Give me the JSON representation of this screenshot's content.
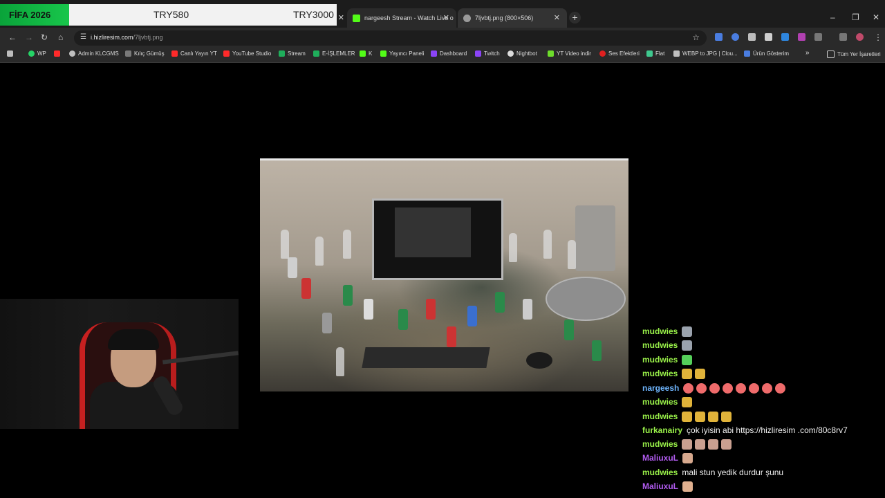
{
  "banner": {
    "green_text": "FİFA 2026",
    "mid_text": "TRY580",
    "right_text": "TRY3000"
  },
  "tabs": [
    {
      "title": "nargeesh Stream - Watch Live o",
      "favicon_color": "#53fc18"
    },
    {
      "title": "7ljvbtj.png (800×506)",
      "favicon_color": "#9a9a9a"
    }
  ],
  "address": {
    "domain": "i.hizliresim.com",
    "path": "/7ljvbtj.png"
  },
  "bookmarks": [
    {
      "label": "WP",
      "color": "#25d366"
    },
    {
      "label": "",
      "color": "#ff2a2a"
    },
    {
      "label": "Admin KLCGMS",
      "color": "#bfbfbf"
    },
    {
      "label": "Kılıç Gümüş",
      "color": "#7a7a7a"
    },
    {
      "label": "Canlı Yayın YT",
      "color": "#ff2a2a"
    },
    {
      "label": "YouTube Studio",
      "color": "#ff2a2a"
    },
    {
      "label": "Stream",
      "color": "#1fae5b"
    },
    {
      "label": "E-İŞLEMLER",
      "color": "#1fae5b"
    },
    {
      "label": "K",
      "color": "#53fc18"
    },
    {
      "label": "Yayıncı Paneli",
      "color": "#53fc18"
    },
    {
      "label": "Dashboard",
      "color": "#8b44f7"
    },
    {
      "label": "Twitch",
      "color": "#8b44f7"
    },
    {
      "label": "Nightbot",
      "color": "#dcdcdc"
    },
    {
      "label": "YT Video indir",
      "color": "#6ddc2b"
    },
    {
      "label": "Ses Efektleri",
      "color": "#e02020"
    },
    {
      "label": "Flat",
      "color": "#3fc98f"
    },
    {
      "label": "WEBP to JPG | Clou...",
      "color": "#bfbfbf"
    },
    {
      "label": "Ürün Gösterim",
      "color": "#4a7de0"
    }
  ],
  "bookmarks_overflow": "»",
  "all_bookmarks": "Tüm Yer İşaretleri",
  "chat": [
    {
      "user": "mudwies",
      "user_color": "#9bf34a",
      "emotes": 1,
      "emote_color": "#9aa2ad",
      "text": ""
    },
    {
      "user": "mudwies",
      "user_color": "#9bf34a",
      "emotes": 1,
      "emote_color": "#9aa2ad",
      "text": ""
    },
    {
      "user": "mudwies",
      "user_color": "#9bf34a",
      "emotes": 1,
      "emote_color": "#55d05a",
      "text": ""
    },
    {
      "user": "mudwies",
      "user_color": "#9bf34a",
      "emotes": 2,
      "emote_color": "#e0b33a",
      "text": ""
    },
    {
      "user": "nargeesh",
      "user_color": "#6fb6ff",
      "emotes": 8,
      "emote_color": "#ef6b6b",
      "text": ""
    },
    {
      "user": "mudwies",
      "user_color": "#9bf34a",
      "emotes": 1,
      "emote_color": "#e0b33a",
      "text": ""
    },
    {
      "user": "mudwies",
      "user_color": "#9bf34a",
      "emotes": 4,
      "emote_color": "#e0b33a",
      "text": ""
    },
    {
      "user": "furkanairy",
      "user_color": "#9bf34a",
      "emotes": 0,
      "emote_color": "",
      "text": "çok iyisin abi https://hizliresim .com/80c8rv7"
    },
    {
      "user": "mudwies",
      "user_color": "#9bf34a",
      "emotes": 4,
      "emote_color": "#c9a090",
      "text": ""
    },
    {
      "user": "MaliuxuL",
      "user_color": "#b25cf0",
      "emotes": 1,
      "emote_color": "#d7a98e",
      "text": ""
    },
    {
      "user": "mudwies",
      "user_color": "#9bf34a",
      "emotes": 0,
      "emote_color": "",
      "text": "mali stun yedik durdur şunu"
    },
    {
      "user": "MaliuxuL",
      "user_color": "#b25cf0",
      "emotes": 1,
      "emote_color": "#e0b08f",
      "text": ""
    }
  ]
}
